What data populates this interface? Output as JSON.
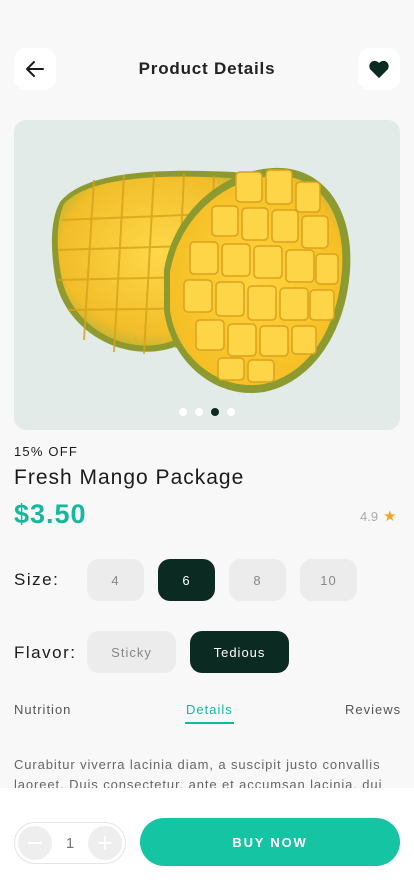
{
  "header": {
    "title": "Product Details",
    "back_icon": "arrow-left-icon",
    "favorite_icon": "heart-icon"
  },
  "gallery": {
    "image_count": 4,
    "active_index": 2
  },
  "product": {
    "discount": "15% OFF",
    "name": "Fresh Mango Package",
    "price": "$3.50",
    "rating": "4.9"
  },
  "size": {
    "label": "Size:",
    "options": [
      "4",
      "6",
      "8",
      "10"
    ],
    "selected": "6"
  },
  "flavor": {
    "label": "Flavor:",
    "options": [
      "Sticky",
      "Tedious"
    ],
    "selected": "Tedious"
  },
  "tabs": {
    "items": [
      "Nutrition",
      "Details",
      "Reviews"
    ],
    "active": "Details"
  },
  "description": "Curabitur viverra lacinia diam, a suscipit justo convallis laoreet. Duis consectetur, ante et accumsan lacinia, dui",
  "footer": {
    "quantity": "1",
    "buy_label": "BUY NOW"
  },
  "colors": {
    "accent": "#14b99d",
    "dark": "#0b2b22",
    "star": "#f2a526"
  }
}
